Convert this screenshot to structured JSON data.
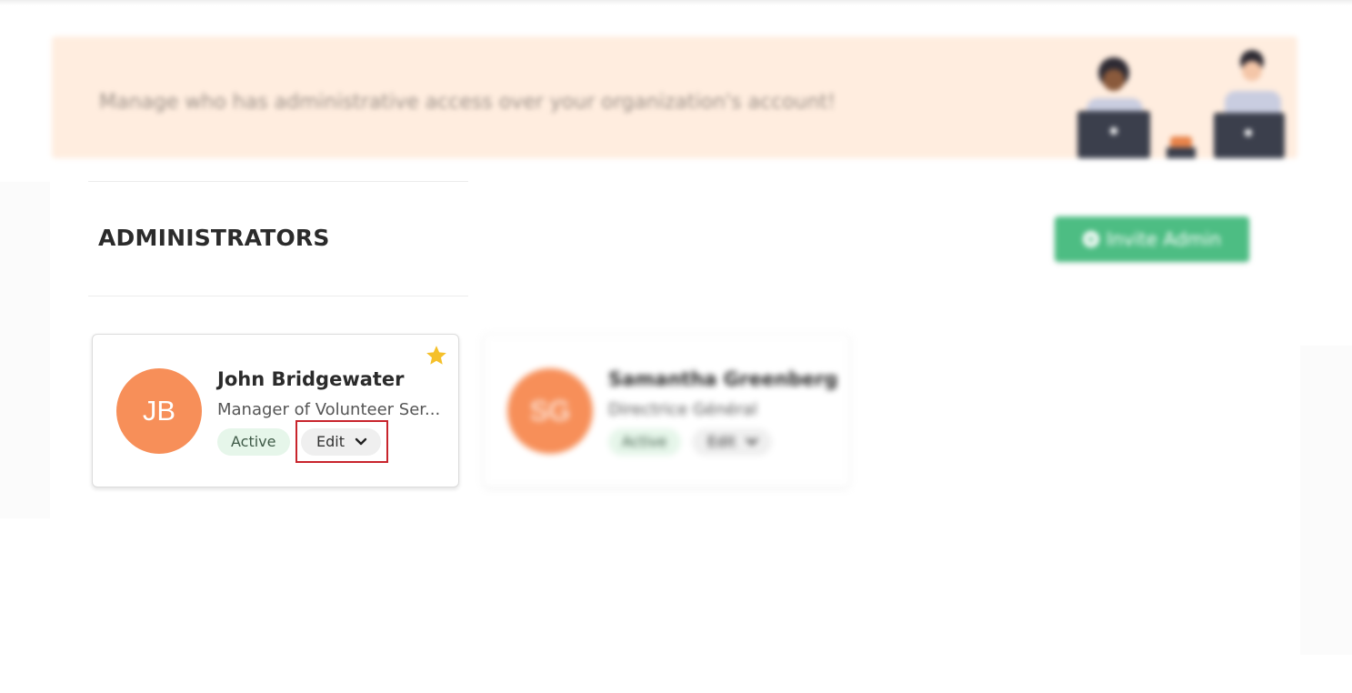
{
  "banner": {
    "text": "Manage who has administrative access over your organization's account!",
    "illustration": "two-people-at-laptops-illustration"
  },
  "section": {
    "title": "ADMINISTRATORS"
  },
  "invite_button": {
    "label": "Invite Admin",
    "icon": "plus-circle-icon"
  },
  "admins": [
    {
      "initials": "JB",
      "name": "John Bridgewater",
      "role": "Manager of Volunteer Ser...",
      "status": "Active",
      "edit_label": "Edit",
      "is_owner": true
    },
    {
      "initials": "SG",
      "name": "Samantha Greenberg",
      "role": "Directrice Général",
      "status": "Active",
      "edit_label": "Edit",
      "is_owner": false
    }
  ],
  "colors": {
    "banner_bg": "#ffeddf",
    "avatar": "#f78f59",
    "invite_button": "#4dbd83",
    "active_badge_bg": "#e6f6ea",
    "star": "#f5c02a",
    "highlight": "#c8242c"
  }
}
